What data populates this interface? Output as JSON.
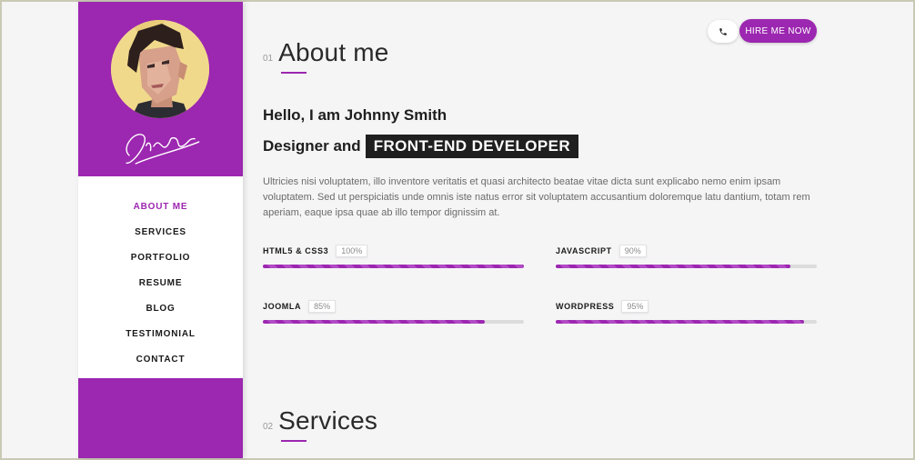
{
  "sidebar": {
    "signature": "Signature",
    "nav": [
      "ABOUT ME",
      "SERVICES",
      "PORTFOLIO",
      "RESUME",
      "BLOG",
      "TESTIMONIAL",
      "CONTACT"
    ],
    "active": "ABOUT ME"
  },
  "header": {
    "phone_icon": "phone-icon",
    "hire_label": "HIRE ME NOW"
  },
  "about": {
    "num": "01",
    "title": "About me",
    "hello": "Hello, I am Johnny Smith",
    "role_prefix": "Designer and",
    "role_highlight": "FRONT-END DEVELOPER",
    "intro": "Ultricies nisi voluptatem, illo inventore veritatis et quasi architecto beatae vitae dicta sunt explicabo nemo enim ipsam voluptatem. Sed ut perspiciatis unde omnis iste natus error sit voluptatem accusantium doloremque latu dantium, totam rem aperiam, eaque ipsa quae ab illo tempor dignissim at.",
    "skills": [
      {
        "name": "HTML5 & CSS3",
        "pct_label": "100%",
        "value": 100
      },
      {
        "name": "JAVASCRIPT",
        "pct_label": "90%",
        "value": 90
      },
      {
        "name": "JOOMLA",
        "pct_label": "85%",
        "value": 85
      },
      {
        "name": "WORDPRESS",
        "pct_label": "95%",
        "value": 95
      }
    ]
  },
  "services": {
    "num": "02",
    "title": "Services"
  },
  "colors": {
    "accent": "#9c27b0",
    "background": "#f5f5f6",
    "highlight_bg": "#1f1f1f"
  }
}
